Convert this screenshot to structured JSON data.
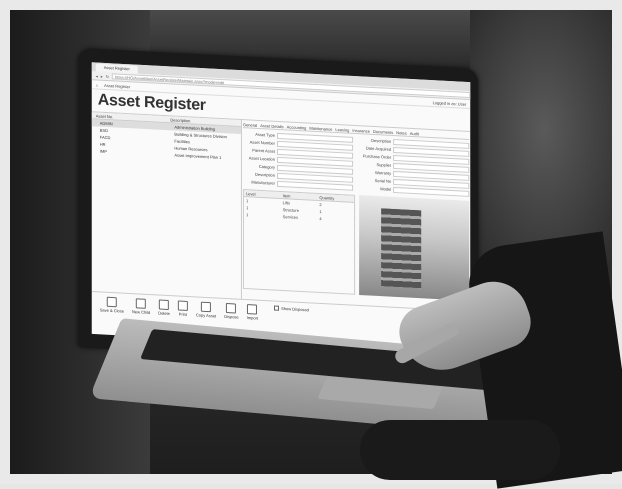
{
  "browser": {
    "tab_title": "Asset Register",
    "address": "https://HQ/AssetMan/AssetRegisterMaintain.aspx?mode=edit"
  },
  "app": {
    "nav": "Asset Register",
    "user": "Logged in as: User",
    "title": "Asset Register"
  },
  "tree": {
    "headers": [
      "Asset No.",
      "Description"
    ],
    "rows": [
      {
        "no": "ADMIN",
        "desc": "Administration Building"
      },
      {
        "no": "BSD",
        "desc": "Building & Structures Division"
      },
      {
        "no": "FACD",
        "desc": "Facilities"
      },
      {
        "no": "HR",
        "desc": "Human Resources"
      },
      {
        "no": "IMP",
        "desc": "Asset Improvement Plan 1"
      }
    ]
  },
  "detail": {
    "tabs": [
      "General",
      "Asset Details",
      "Accounting",
      "Maintenance",
      "Leasing",
      "Insurance",
      "Documents",
      "Notes",
      "Audit"
    ],
    "left_fields": [
      "Asset Type",
      "Asset Number",
      "Parent Asset",
      "Asset Location",
      "Category",
      "Description",
      "Manufacturer",
      "Model"
    ],
    "right_fields": [
      "Description",
      "Date Acquired",
      "Purchase Order",
      "Supplier",
      "Warranty",
      "Serial No"
    ]
  },
  "subtable": {
    "headers": [
      "Level",
      "Item",
      "Quantity"
    ],
    "rows": [
      [
        "1",
        "Lifts",
        "2"
      ],
      [
        "1",
        "Structure",
        "1"
      ],
      [
        "1",
        "Services",
        "4"
      ]
    ]
  },
  "toolbar": {
    "buttons": [
      "Save & Close",
      "New Child",
      "Delete",
      "Print",
      "Copy Asset",
      "Dispose",
      "Import",
      "Export"
    ],
    "checkbox_label": "Show Disposed"
  }
}
